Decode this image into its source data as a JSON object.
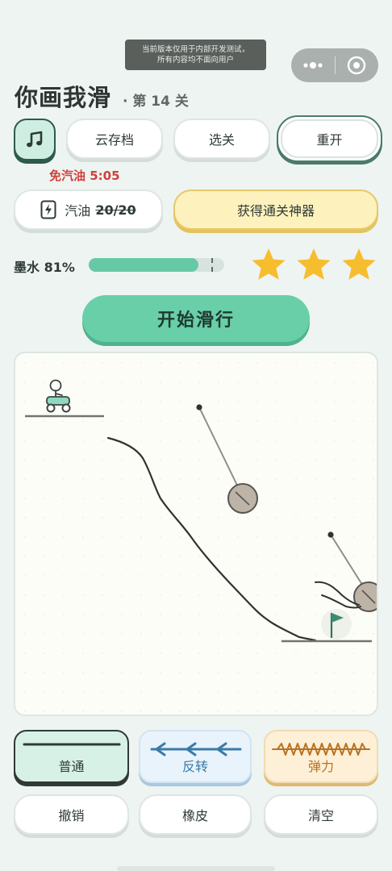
{
  "notice": {
    "line1": "当前版本仅用于内部开发测试，",
    "line2": "所有内容均不面向用户"
  },
  "header": {
    "title": "你画我滑",
    "level": "· 第 14 关"
  },
  "toolbar": {
    "save_label": "云存档",
    "select_label": "选关",
    "restart_label": "重开"
  },
  "gas": {
    "free_timer": "免汽油 5:05",
    "label": "汽油",
    "value": "20/20",
    "gift_label": "获得通关神器"
  },
  "ink": {
    "label": "墨水 81%",
    "percent": 81
  },
  "stars": {
    "count": 3,
    "filled": 3,
    "color": "#f6bd2f"
  },
  "start_label": "开始滑行",
  "tools": {
    "normal_label": "普通",
    "reverse_label": "反转",
    "bounce_label": "弹力"
  },
  "actions": {
    "undo_label": "撤销",
    "eraser_label": "橡皮",
    "clear_label": "清空"
  },
  "colors": {
    "accent": "#68cfa9",
    "danger": "#d0413c",
    "gift_bg": "#fdf1bd"
  }
}
